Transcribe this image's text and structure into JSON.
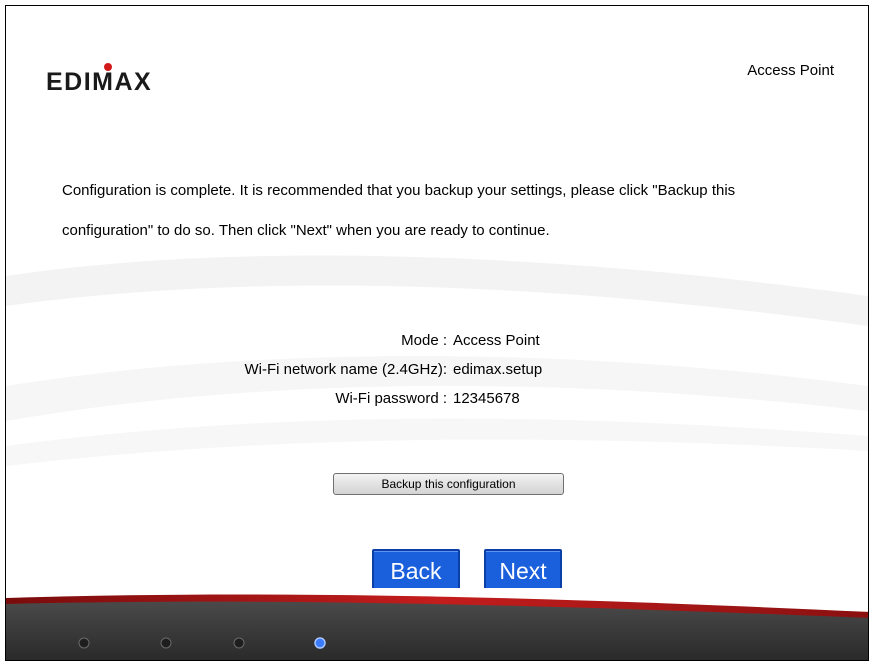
{
  "header": {
    "brand": "EDIMAX",
    "mode_title": "Access Point"
  },
  "message": {
    "line1": "Configuration is complete. It is recommended that you backup your settings, please click \"Backup this",
    "line2": "configuration\" to do so. Then click \"Next\" when you are ready to continue."
  },
  "settings": [
    {
      "label": "Mode :",
      "value": "Access Point"
    },
    {
      "label": "Wi-Fi network name (2.4GHz):",
      "value": "edimax.setup"
    },
    {
      "label": "Wi-Fi password :",
      "value": "12345678"
    }
  ],
  "buttons": {
    "backup_label": "Backup this configuration",
    "back_label": "Back",
    "next_label": "Next"
  },
  "footer": {
    "step_indicators": [
      "inactive",
      "inactive",
      "inactive",
      "active"
    ]
  },
  "colors": {
    "nav_button": "#1a5fdc",
    "footer_dark": "#3a3a3a",
    "footer_red": "#b01818",
    "active_dot": "#3a7bff"
  },
  "icons": {
    "logo": "edimax-logo",
    "step_dot": "circle-dot-icon"
  }
}
